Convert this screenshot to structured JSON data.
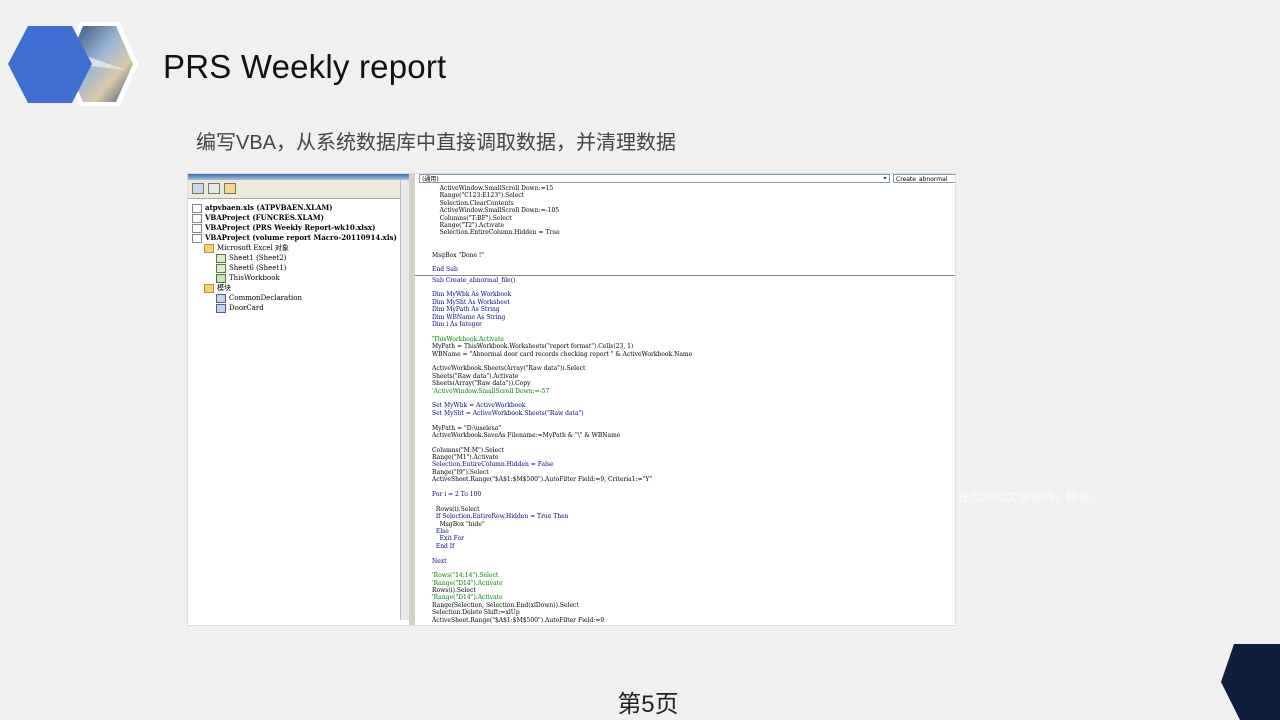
{
  "slide": {
    "title": "PRS Weekly report",
    "subtitle": "编写VBA，从系统数据库中直接调取数据，并清理数据",
    "ghost_note": "在此添加文字说明，模板。",
    "page_number": "第5页"
  },
  "vba_editor": {
    "procedure_combo": "(通用)",
    "proc_name_combo": "Create_abnormal_",
    "project_tree": [
      {
        "label": "atpvbaen.xls (ATPVBAEN.XLAM)",
        "bold": true,
        "indent": 0,
        "icon": "expand-icon"
      },
      {
        "label": "VBAProject (FUNCRES.XLAM)",
        "bold": true,
        "indent": 0,
        "icon": "expand-icon"
      },
      {
        "label": "VBAProject (PRS Weekly Report-wk10.xlsx)",
        "bold": true,
        "indent": 0,
        "icon": "expand-icon"
      },
      {
        "label": "VBAProject (volume report Macro-20110914.xls)",
        "bold": true,
        "indent": 0,
        "icon": "collapse-icon"
      },
      {
        "label": "Microsoft Excel 对象",
        "bold": false,
        "indent": 1,
        "icon": "folder-icon"
      },
      {
        "label": "Sheet1 (Sheet2)",
        "bold": false,
        "indent": 2,
        "icon": "sheet-icon"
      },
      {
        "label": "Sheet6 (Sheet1)",
        "bold": false,
        "indent": 2,
        "icon": "sheet-icon"
      },
      {
        "label": "ThisWorkbook",
        "bold": false,
        "indent": 2,
        "icon": "workbook-icon"
      },
      {
        "label": "模块",
        "bold": false,
        "indent": 1,
        "icon": "folder-icon"
      },
      {
        "label": "CommonDeclaration",
        "bold": false,
        "indent": 2,
        "icon": "module-icon"
      },
      {
        "label": "DoorCard",
        "bold": false,
        "indent": 2,
        "icon": "module-icon"
      }
    ],
    "code_lines": [
      {
        "t": "    ActiveWindow.SmallScroll Down:=15",
        "c": "n"
      },
      {
        "t": "    Range(\"C123:E123\").Select",
        "c": "n"
      },
      {
        "t": "    Selection.ClearContents",
        "c": "n"
      },
      {
        "t": "    ActiveWindow.SmallScroll Down:=-105",
        "c": "n"
      },
      {
        "t": "    Columns(\"T:BF\").Select",
        "c": "n"
      },
      {
        "t": "    Range(\"T2\").Activate",
        "c": "n"
      },
      {
        "t": "    Selection.EntireColumn.Hidden = True",
        "c": "n"
      },
      {
        "t": "",
        "c": "n"
      },
      {
        "t": "",
        "c": "n"
      },
      {
        "t": "MsgBox \"Done !\"",
        "c": "n"
      },
      {
        "t": "",
        "c": "n"
      },
      {
        "t": "End Sub",
        "c": "k"
      },
      {
        "t": "---",
        "c": "sep"
      },
      {
        "t": "Sub Create_abnormal_file()",
        "c": "k"
      },
      {
        "t": "",
        "c": "n"
      },
      {
        "t": "Dim MyWbk As Workbook",
        "c": "k"
      },
      {
        "t": "Dim MySht As Worksheet",
        "c": "k"
      },
      {
        "t": "Dim MyPath As String",
        "c": "k"
      },
      {
        "t": "Dim WBName As String",
        "c": "k"
      },
      {
        "t": "Dim i As Integer",
        "c": "k"
      },
      {
        "t": "",
        "c": "n"
      },
      {
        "t": "'ThisWorkbook.Activate",
        "c": "c"
      },
      {
        "t": "MyPath = ThisWorkbook.Worksheets(\"report format\").Cells(23, 1)",
        "c": "n"
      },
      {
        "t": "WBName = \"Abnormal door card records checking report \" & ActiveWorkbook.Name",
        "c": "n"
      },
      {
        "t": "",
        "c": "n"
      },
      {
        "t": "ActiveWorkbook.Sheets(Array(\"Raw data\")).Select",
        "c": "n"
      },
      {
        "t": "Sheets(\"Raw data\").Activate",
        "c": "n"
      },
      {
        "t": "Sheets(Array(\"Raw data\")).Copy",
        "c": "n"
      },
      {
        "t": "'ActiveWindow.SmallScroll Down:=-57",
        "c": "c"
      },
      {
        "t": "",
        "c": "n"
      },
      {
        "t": "Set MyWbk = ActiveWorkbook",
        "c": "k"
      },
      {
        "t": "Set MySht = ActiveWorkbook.Sheets(\"Raw data\")",
        "c": "k"
      },
      {
        "t": "",
        "c": "n"
      },
      {
        "t": "MyPath = \"D:\\uselesa\"",
        "c": "n"
      },
      {
        "t": "ActiveWorkbook.SaveAs Filename:=MyPath & \"\\\" & WBName",
        "c": "n"
      },
      {
        "t": "",
        "c": "n"
      },
      {
        "t": "Columns(\"M:M\").Select",
        "c": "n"
      },
      {
        "t": "Range(\"M1\").Activate",
        "c": "n"
      },
      {
        "t": "Selection.EntireColumn.Hidden = False",
        "c": "k"
      },
      {
        "t": "Range(\"I9\").Select",
        "c": "n"
      },
      {
        "t": "ActiveSheet.Range(\"$A$1:$M$500\").AutoFilter Field:=9, Criteria1:=\"Y\"",
        "c": "n"
      },
      {
        "t": "",
        "c": "n"
      },
      {
        "t": "For i = 2 To 100",
        "c": "k"
      },
      {
        "t": "",
        "c": "n"
      },
      {
        "t": "  Rows(i).Select",
        "c": "n"
      },
      {
        "t": "  If Selection.EntireRow.Hidden = True Then",
        "c": "k"
      },
      {
        "t": "    MsgBox \"hide\"",
        "c": "n"
      },
      {
        "t": "  Else",
        "c": "k"
      },
      {
        "t": "    Exit For",
        "c": "k"
      },
      {
        "t": "  End If",
        "c": "k"
      },
      {
        "t": "",
        "c": "n"
      },
      {
        "t": "Next",
        "c": "k"
      },
      {
        "t": "",
        "c": "n"
      },
      {
        "t": "'Rows(\"14:14\").Select",
        "c": "c"
      },
      {
        "t": "'Range(\"D14\").Activate",
        "c": "c"
      },
      {
        "t": "Rows(i).Select",
        "c": "n"
      },
      {
        "t": "'Range(\"D14\").Activate",
        "c": "c"
      },
      {
        "t": "Range(Selection, Selection.End(xlDown)).Select",
        "c": "n"
      },
      {
        "t": "Selection.Delete Shift:=xlUp",
        "c": "n"
      },
      {
        "t": "ActiveSheet.Range(\"$A$1:$M$500\").AutoFilter Field:=9",
        "c": "n"
      }
    ]
  },
  "colors": {
    "logo_blue": "#3e6fd0",
    "corner_navy": "#0e1f3c",
    "background": "#f0f0f0"
  }
}
